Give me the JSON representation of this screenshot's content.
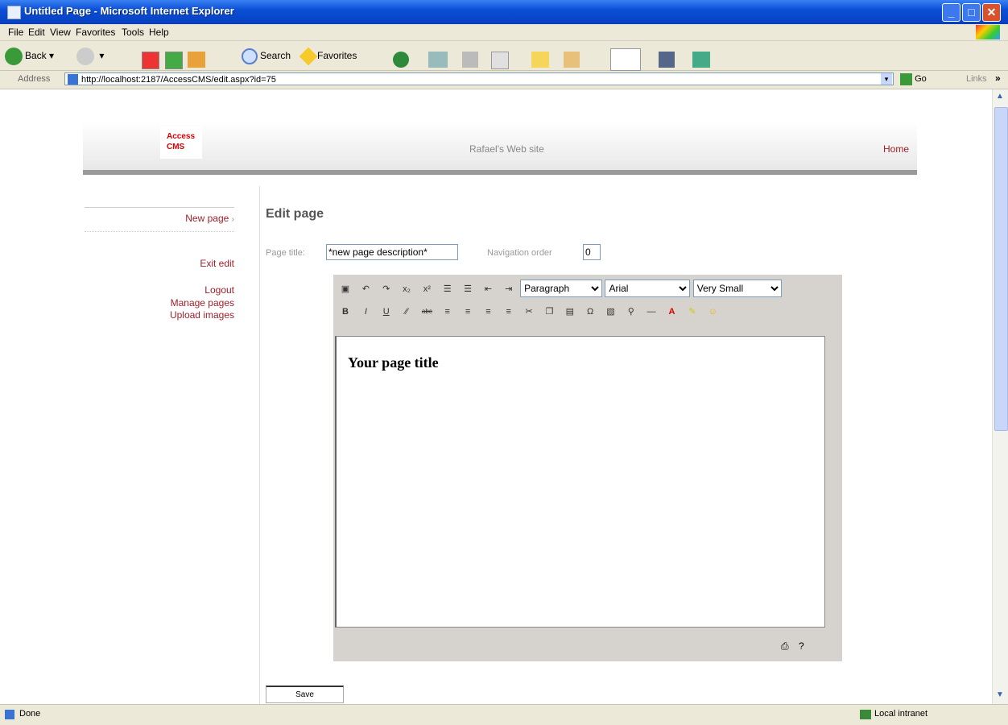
{
  "window": {
    "title": "Untitled Page - Microsoft Internet Explorer"
  },
  "menu": [
    "File",
    "Edit",
    "View",
    "Favorites",
    "Tools",
    "Help"
  ],
  "toolbar": {
    "back": "Back",
    "search": "Search",
    "favorites": "Favorites"
  },
  "address": {
    "label": "Address",
    "url": "http://localhost:2187/AccessCMS/edit.aspx?id=75",
    "go": "Go",
    "links": "Links"
  },
  "site": {
    "logo_line1": "Access",
    "logo_line2": "CMS",
    "site_name": "Rafael's Web site",
    "home_link": "Home"
  },
  "sidebar": {
    "current_page": "New page",
    "exit_edit": "Exit edit",
    "logout": "Logout",
    "manage_pages": "Manage pages",
    "upload_images": "Upload images"
  },
  "form": {
    "heading": "Edit page",
    "page_title_label": "Page title:",
    "page_title_value": "*new page description*",
    "nav_order_label": "Navigation order",
    "nav_order_value": "0",
    "save_label": "Save"
  },
  "editor": {
    "format_value": "Paragraph",
    "font_value": "Arial",
    "size_value": "Very Small",
    "content_heading": "Your page title"
  },
  "status": {
    "text": "Done",
    "zone": "Local intranet"
  }
}
